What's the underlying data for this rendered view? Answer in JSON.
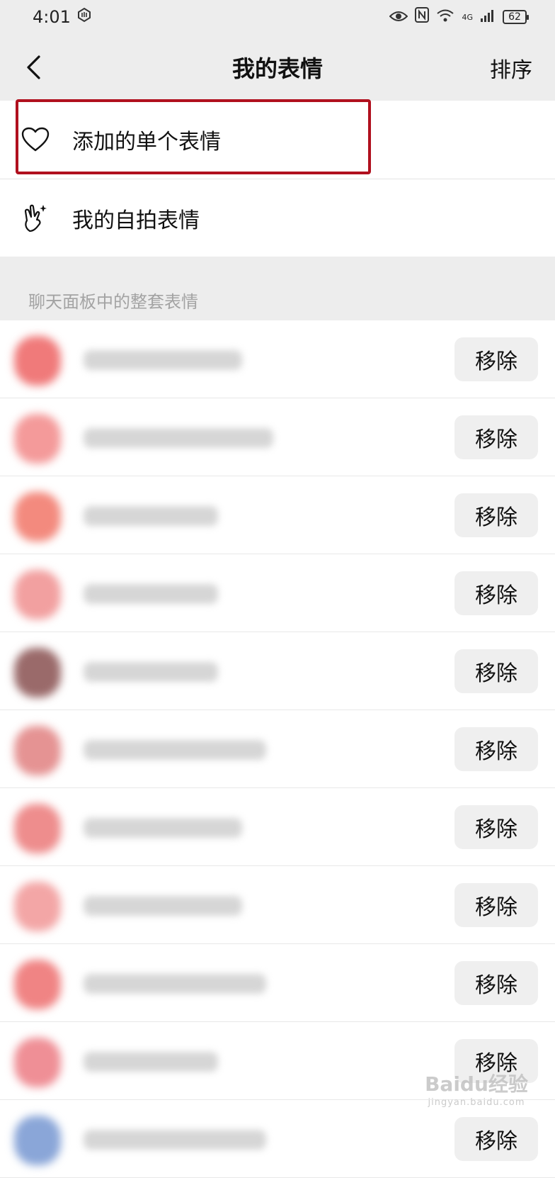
{
  "status_bar": {
    "time": "4:01",
    "battery": "62",
    "network": "4G"
  },
  "nav": {
    "title": "我的表情",
    "sort_label": "排序"
  },
  "menu": [
    {
      "label": "添加的单个表情",
      "icon": "heart-icon"
    },
    {
      "label": "我的自拍表情",
      "icon": "selfie-hand-icon"
    }
  ],
  "section": {
    "header": "聊天面板中的整套表情"
  },
  "stickers": [
    {
      "remove_label": "移除",
      "thumb_color": "#f07a7a"
    },
    {
      "remove_label": "移除",
      "thumb_color": "#f49a9a"
    },
    {
      "remove_label": "移除",
      "thumb_color": "#f38a7e"
    },
    {
      "remove_label": "移除",
      "thumb_color": "#f2a0a0"
    },
    {
      "remove_label": "移除",
      "thumb_color": "#9a6a6a"
    },
    {
      "remove_label": "移除",
      "thumb_color": "#e59393"
    },
    {
      "remove_label": "移除",
      "thumb_color": "#ee8d8d"
    },
    {
      "remove_label": "移除",
      "thumb_color": "#f3a6a6"
    },
    {
      "remove_label": "移除",
      "thumb_color": "#f08484"
    },
    {
      "remove_label": "移除",
      "thumb_color": "#ef8f96"
    },
    {
      "remove_label": "移除",
      "thumb_color": "#8aa6d8"
    }
  ],
  "watermark": {
    "text": "Baidu经验",
    "sub": "jingyan.baidu.com"
  }
}
